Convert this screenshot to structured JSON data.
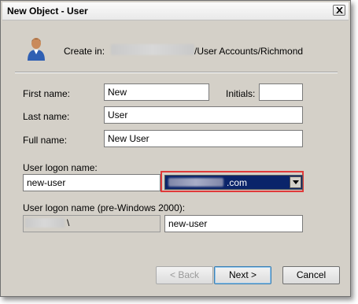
{
  "window": {
    "title": "New Object - User"
  },
  "header": {
    "create_in_label": "Create in:",
    "create_in_path": "/User Accounts/Richmond"
  },
  "form": {
    "first_name_label": "First name:",
    "first_name_value": "New",
    "initials_label": "Initials:",
    "initials_value": "",
    "last_name_label": "Last name:",
    "last_name_value": "User",
    "full_name_label": "Full name:",
    "full_name_value": "New User",
    "logon_name_label": "User logon name:",
    "logon_name_value": "new-user",
    "upn_suffix_value": ".com",
    "pre2000_label": "User logon name (pre-Windows 2000):",
    "pre2000_domain_suffix": "\\",
    "pre2000_value": "new-user"
  },
  "buttons": {
    "back": "< Back",
    "next": "Next >",
    "cancel": "Cancel"
  },
  "colors": {
    "dialog_bg": "#d4d0c8",
    "selection": "#0a246a",
    "highlight_border": "#e03a3a"
  }
}
